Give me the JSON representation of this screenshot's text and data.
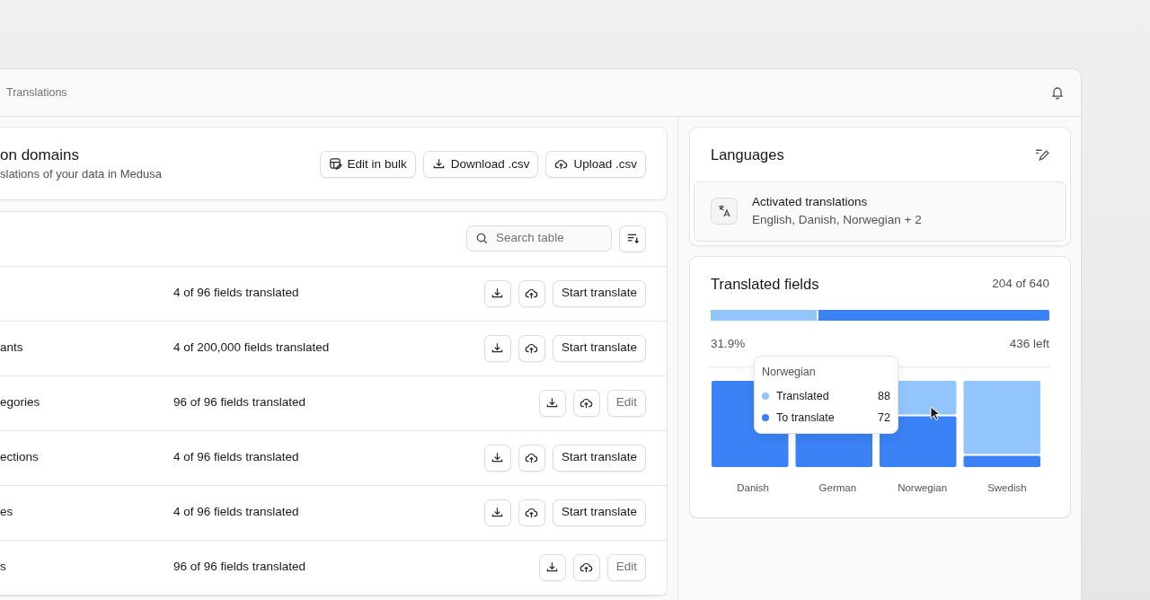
{
  "breadcrumb": "Translations",
  "header": {
    "title": "on domains",
    "subtitle": "slations of your data in Medusa",
    "actions": [
      {
        "label": "Edit in bulk",
        "kind": "table-edit"
      },
      {
        "label": "Download .csv",
        "kind": "download"
      },
      {
        "label": "Upload .csv",
        "kind": "upload"
      }
    ]
  },
  "table": {
    "search": {
      "placeholder": "Search table"
    },
    "rows": [
      {
        "progress": "4 of 96 fields translated",
        "action": "Start translate",
        "kind": "start"
      },
      {
        "name": "ants",
        "progress": "4 of 200,000 fields translated",
        "action": "Start translate",
        "kind": "start"
      },
      {
        "name": "egories",
        "progress": "96 of 96 fields translated",
        "action": "Edit",
        "kind": "edit"
      },
      {
        "name": "ections",
        "progress": "4 of 96 fields translated",
        "action": "Start translate",
        "kind": "start"
      },
      {
        "name": "es",
        "progress": "4 of 96 fields translated",
        "action": "Start translate",
        "kind": "start"
      },
      {
        "name": "s",
        "progress": "96 of 96 fields translated",
        "action": "Edit",
        "kind": "edit"
      }
    ]
  },
  "languages": {
    "title": "Languages",
    "item": {
      "title": "Activated translations",
      "subtitle": "English, Danish, Norwegian + 2"
    }
  },
  "translated": {
    "title": "Translated fields",
    "count": "204 of 640",
    "level": 0.319,
    "percent": "31.9%",
    "left": "436 left",
    "categories": [
      "Danish",
      "German",
      "Norwegian",
      "Swedish"
    ],
    "tooltip": {
      "title": "Norwegian",
      "items": [
        {
          "label": "Translated",
          "value": "88",
          "color": "#93c5fd"
        },
        {
          "label": "To translate",
          "value": "72",
          "color": "#3b82f6"
        }
      ]
    }
  }
}
